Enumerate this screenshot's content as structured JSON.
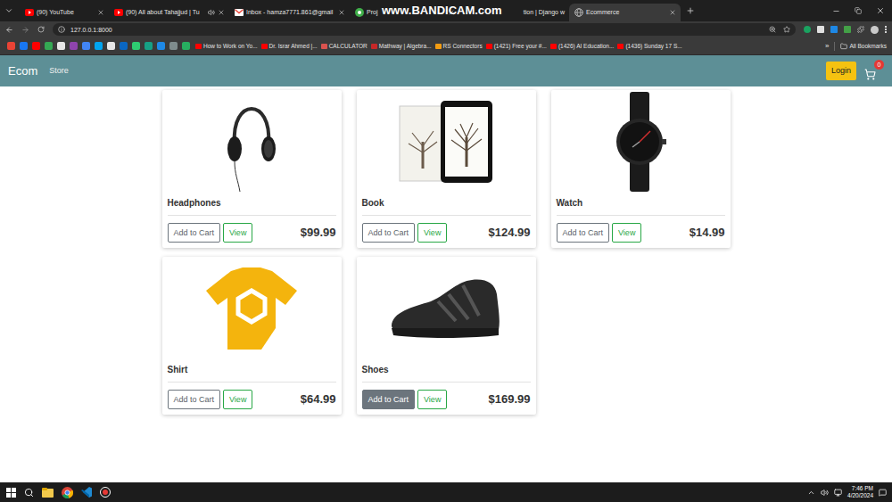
{
  "browser": {
    "tabs": [
      {
        "label": "(90) YouTube",
        "selected": false,
        "audio": false,
        "kind": "normal"
      },
      {
        "label": "(90) All about Tahajjud | Tu",
        "selected": false,
        "audio": true,
        "kind": "normal"
      },
      {
        "label": "Inbox - hamza7771.861@gmail",
        "selected": false,
        "audio": false,
        "kind": "normal"
      },
      {
        "label": "Proj",
        "selected": false,
        "audio": false,
        "kind": "normal"
      },
      {
        "label": "tion | Django w",
        "selected": false,
        "audio": false,
        "kind": "cut_start"
      },
      {
        "label": "Ecommerce",
        "selected": true,
        "audio": false,
        "kind": "normal"
      }
    ],
    "address": "127.0.0.1:8000",
    "bookmarks": [
      "How to Work on Yo...",
      "Dr. Israr Ahmed |...",
      "CALCULATOR",
      "Mathway | Algebra...",
      "RS Connectors",
      "(1421) Free your #...",
      "(1426) AI Education...",
      "(1436) Sunday 17 S..."
    ],
    "bookmarks_more": "»",
    "all_bookmarks": "All Bookmarks"
  },
  "watermark": "www.BANDICAM.com",
  "navbar": {
    "brand": "Ecom",
    "links": [
      "Store"
    ],
    "login": "Login",
    "cart_count": "0"
  },
  "products": [
    {
      "name": "Headphones",
      "price": "$99.99",
      "add_label": "Add to Cart",
      "view_label": "View",
      "add_hovered": false
    },
    {
      "name": "Book",
      "price": "$124.99",
      "add_label": "Add to Cart",
      "view_label": "View",
      "add_hovered": false
    },
    {
      "name": "Watch",
      "price": "$14.99",
      "add_label": "Add to Cart",
      "view_label": "View",
      "add_hovered": false
    },
    {
      "name": "Shirt",
      "price": "$64.99",
      "add_label": "Add to Cart",
      "view_label": "View",
      "add_hovered": false
    },
    {
      "name": "Shoes",
      "price": "$169.99",
      "add_label": "Add to Cart",
      "view_label": "View",
      "add_hovered": true
    }
  ],
  "taskbar": {
    "time": "7:46 PM",
    "date": "4/20/2024"
  }
}
